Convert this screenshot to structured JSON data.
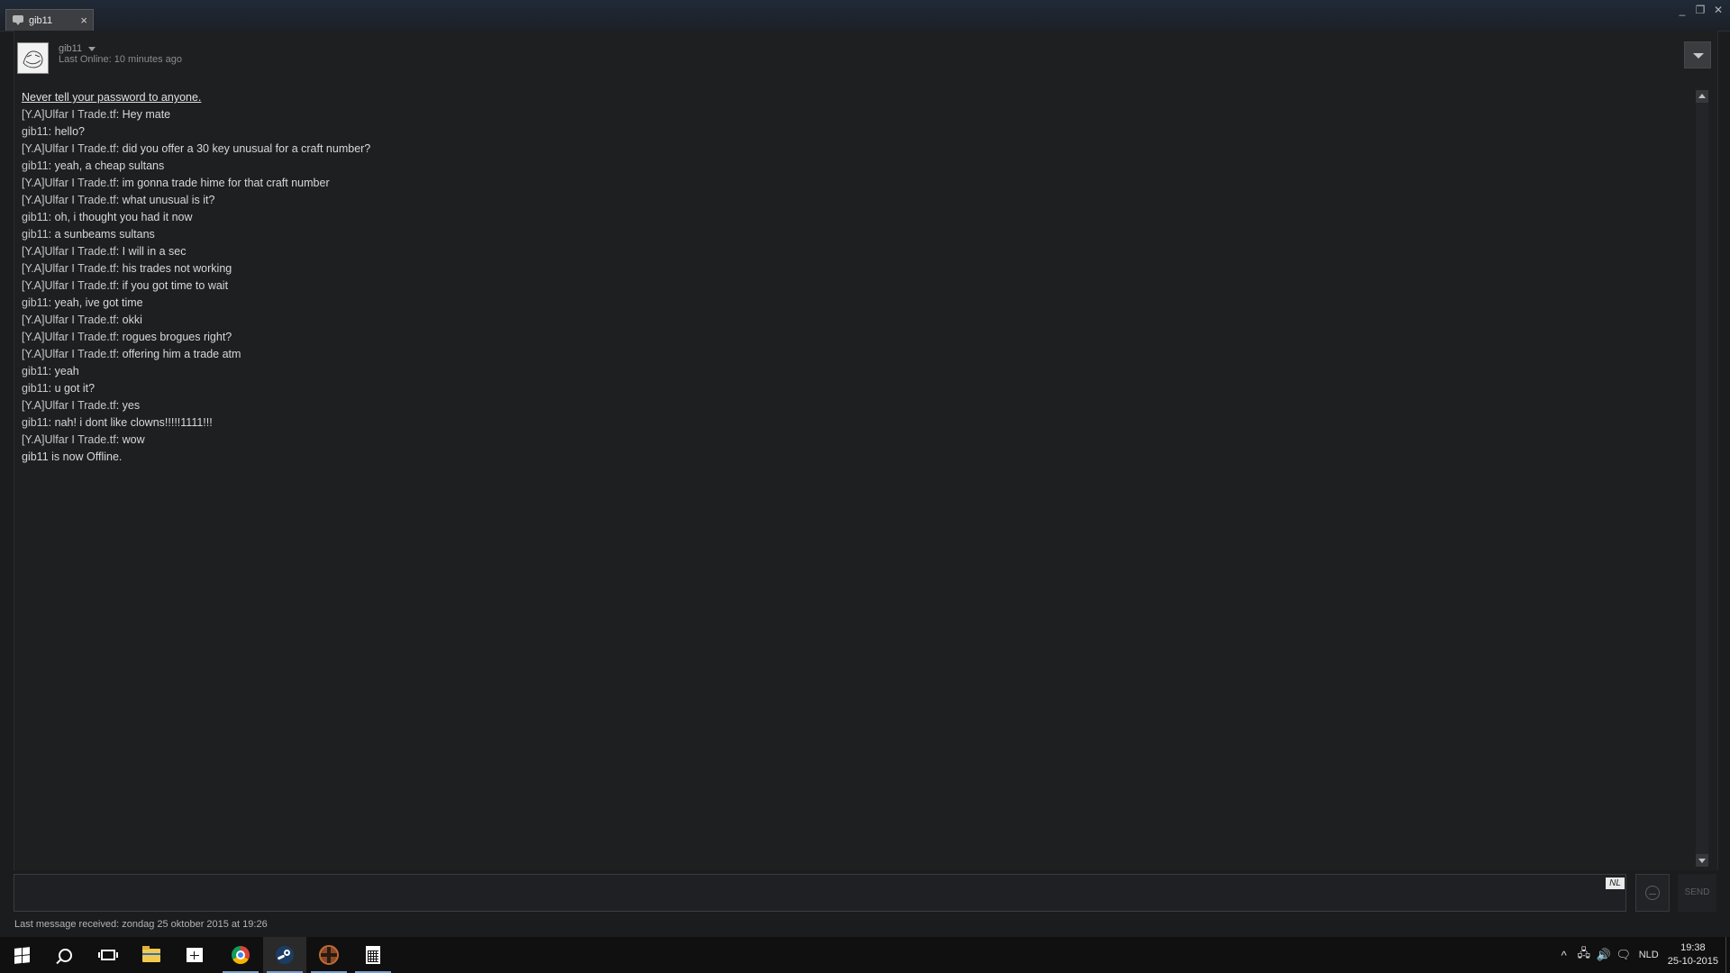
{
  "window": {
    "tab_label": "gib11",
    "tab_close": "×",
    "minimize": "_",
    "maximize": "❐",
    "close": "✕"
  },
  "header": {
    "friend_name": "gib11",
    "last_online": "Last Online: 10 minutes ago"
  },
  "chat": {
    "warning": "Never tell your password to anyone.",
    "messages": [
      {
        "sender": "[Y.A]Ulfar I Trade.tf",
        "text": ": Hey mate"
      },
      {
        "sender": "gib11",
        "text": ": hello?"
      },
      {
        "sender": "[Y.A]Ulfar I Trade.tf",
        "text": ": did you offer a 30 key unusual for a craft number?"
      },
      {
        "sender": "gib11",
        "text": ": yeah, a cheap sultans"
      },
      {
        "sender": "[Y.A]Ulfar I Trade.tf",
        "text": ": im gonna trade hime for that craft number"
      },
      {
        "sender": "[Y.A]Ulfar I Trade.tf",
        "text": ": what unusual is it?"
      },
      {
        "sender": "gib11",
        "text": ": oh, i thought you had it now"
      },
      {
        "sender": "gib11",
        "text": ": a sunbeams sultans"
      },
      {
        "sender": "[Y.A]Ulfar I Trade.tf",
        "text": ": I will in a sec"
      },
      {
        "sender": "[Y.A]Ulfar I Trade.tf",
        "text": ": his trades not working"
      },
      {
        "sender": "[Y.A]Ulfar I Trade.tf",
        "text": ": if you got time to wait"
      },
      {
        "sender": "gib11",
        "text": ": yeah, ive got time"
      },
      {
        "sender": "[Y.A]Ulfar I Trade.tf",
        "text": ": okki"
      },
      {
        "sender": "[Y.A]Ulfar I Trade.tf",
        "text": ": rogues brogues right?"
      },
      {
        "sender": "[Y.A]Ulfar I Trade.tf",
        "text": ": offering him a trade atm"
      },
      {
        "sender": "gib11",
        "text": ": yeah"
      },
      {
        "sender": "gib11",
        "text": ": u got it?"
      },
      {
        "sender": "[Y.A]Ulfar I Trade.tf",
        "text": ": yes"
      },
      {
        "sender": "gib11",
        "text": ": nah! i dont like clowns!!!!!1111!!!"
      },
      {
        "sender": "[Y.A]Ulfar I Trade.tf",
        "text": ": wow"
      }
    ],
    "status": "gib11 is now Offline."
  },
  "input": {
    "value": "",
    "language_badge": "NL",
    "send_label": "SEND"
  },
  "footer": {
    "last_received": "Last message received: zondag 25 oktober 2015 at 19:26"
  },
  "taskbar": {
    "apps": [
      "start-icon",
      "search-icon",
      "task-view-icon",
      "file-explorer-icon",
      "store-icon",
      "chrome-icon",
      "steam-icon",
      "tf2-icon",
      "calculator-icon"
    ],
    "tray": {
      "chevron": "^",
      "network": "🖧",
      "volume": "🔊",
      "notifications": "🗨",
      "language": "NLD"
    },
    "time": "19:38",
    "date": "25-10-2015"
  },
  "colors": {
    "name_green": "#9dc242",
    "background": "#1e1f21"
  }
}
